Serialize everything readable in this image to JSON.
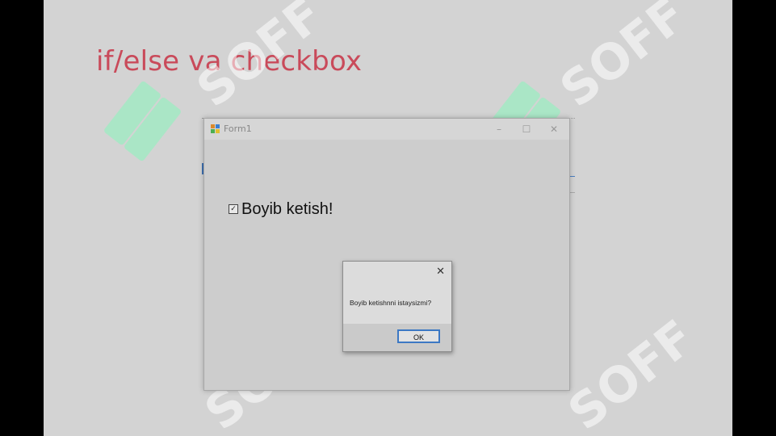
{
  "slide": {
    "title": "if/else va checkbox"
  },
  "form": {
    "title": "Form1",
    "controls": {
      "minimize": "–",
      "maximize": "☐",
      "close": "✕"
    },
    "checkbox": {
      "checked": true,
      "label": "Boyib ketish!"
    }
  },
  "messagebox": {
    "close": "✕",
    "text": "Boyib ketishnni istaysizmi?",
    "ok_label": "OK"
  },
  "watermark": {
    "text": "SOFF"
  },
  "colors": {
    "title": "#c94a5a",
    "watermark_logo": "#a0ebc3",
    "ok_border": "#3c78c4"
  }
}
